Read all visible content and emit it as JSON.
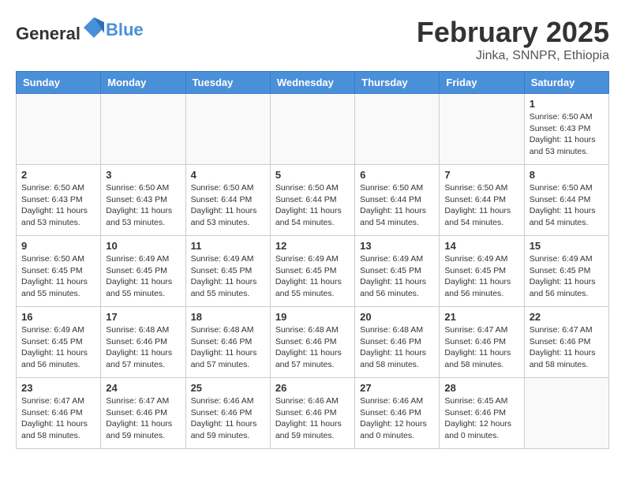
{
  "header": {
    "logo_general": "General",
    "logo_blue": "Blue",
    "month": "February 2025",
    "location": "Jinka, SNNPR, Ethiopia"
  },
  "weekdays": [
    "Sunday",
    "Monday",
    "Tuesday",
    "Wednesday",
    "Thursday",
    "Friday",
    "Saturday"
  ],
  "weeks": [
    [
      {
        "day": "",
        "info": ""
      },
      {
        "day": "",
        "info": ""
      },
      {
        "day": "",
        "info": ""
      },
      {
        "day": "",
        "info": ""
      },
      {
        "day": "",
        "info": ""
      },
      {
        "day": "",
        "info": ""
      },
      {
        "day": "1",
        "info": "Sunrise: 6:50 AM\nSunset: 6:43 PM\nDaylight: 11 hours and 53 minutes."
      }
    ],
    [
      {
        "day": "2",
        "info": "Sunrise: 6:50 AM\nSunset: 6:43 PM\nDaylight: 11 hours and 53 minutes."
      },
      {
        "day": "3",
        "info": "Sunrise: 6:50 AM\nSunset: 6:43 PM\nDaylight: 11 hours and 53 minutes."
      },
      {
        "day": "4",
        "info": "Sunrise: 6:50 AM\nSunset: 6:44 PM\nDaylight: 11 hours and 53 minutes."
      },
      {
        "day": "5",
        "info": "Sunrise: 6:50 AM\nSunset: 6:44 PM\nDaylight: 11 hours and 54 minutes."
      },
      {
        "day": "6",
        "info": "Sunrise: 6:50 AM\nSunset: 6:44 PM\nDaylight: 11 hours and 54 minutes."
      },
      {
        "day": "7",
        "info": "Sunrise: 6:50 AM\nSunset: 6:44 PM\nDaylight: 11 hours and 54 minutes."
      },
      {
        "day": "8",
        "info": "Sunrise: 6:50 AM\nSunset: 6:44 PM\nDaylight: 11 hours and 54 minutes."
      }
    ],
    [
      {
        "day": "9",
        "info": "Sunrise: 6:50 AM\nSunset: 6:45 PM\nDaylight: 11 hours and 55 minutes."
      },
      {
        "day": "10",
        "info": "Sunrise: 6:49 AM\nSunset: 6:45 PM\nDaylight: 11 hours and 55 minutes."
      },
      {
        "day": "11",
        "info": "Sunrise: 6:49 AM\nSunset: 6:45 PM\nDaylight: 11 hours and 55 minutes."
      },
      {
        "day": "12",
        "info": "Sunrise: 6:49 AM\nSunset: 6:45 PM\nDaylight: 11 hours and 55 minutes."
      },
      {
        "day": "13",
        "info": "Sunrise: 6:49 AM\nSunset: 6:45 PM\nDaylight: 11 hours and 56 minutes."
      },
      {
        "day": "14",
        "info": "Sunrise: 6:49 AM\nSunset: 6:45 PM\nDaylight: 11 hours and 56 minutes."
      },
      {
        "day": "15",
        "info": "Sunrise: 6:49 AM\nSunset: 6:45 PM\nDaylight: 11 hours and 56 minutes."
      }
    ],
    [
      {
        "day": "16",
        "info": "Sunrise: 6:49 AM\nSunset: 6:45 PM\nDaylight: 11 hours and 56 minutes."
      },
      {
        "day": "17",
        "info": "Sunrise: 6:48 AM\nSunset: 6:46 PM\nDaylight: 11 hours and 57 minutes."
      },
      {
        "day": "18",
        "info": "Sunrise: 6:48 AM\nSunset: 6:46 PM\nDaylight: 11 hours and 57 minutes."
      },
      {
        "day": "19",
        "info": "Sunrise: 6:48 AM\nSunset: 6:46 PM\nDaylight: 11 hours and 57 minutes."
      },
      {
        "day": "20",
        "info": "Sunrise: 6:48 AM\nSunset: 6:46 PM\nDaylight: 11 hours and 58 minutes."
      },
      {
        "day": "21",
        "info": "Sunrise: 6:47 AM\nSunset: 6:46 PM\nDaylight: 11 hours and 58 minutes."
      },
      {
        "day": "22",
        "info": "Sunrise: 6:47 AM\nSunset: 6:46 PM\nDaylight: 11 hours and 58 minutes."
      }
    ],
    [
      {
        "day": "23",
        "info": "Sunrise: 6:47 AM\nSunset: 6:46 PM\nDaylight: 11 hours and 58 minutes."
      },
      {
        "day": "24",
        "info": "Sunrise: 6:47 AM\nSunset: 6:46 PM\nDaylight: 11 hours and 59 minutes."
      },
      {
        "day": "25",
        "info": "Sunrise: 6:46 AM\nSunset: 6:46 PM\nDaylight: 11 hours and 59 minutes."
      },
      {
        "day": "26",
        "info": "Sunrise: 6:46 AM\nSunset: 6:46 PM\nDaylight: 11 hours and 59 minutes."
      },
      {
        "day": "27",
        "info": "Sunrise: 6:46 AM\nSunset: 6:46 PM\nDaylight: 12 hours and 0 minutes."
      },
      {
        "day": "28",
        "info": "Sunrise: 6:45 AM\nSunset: 6:46 PM\nDaylight: 12 hours and 0 minutes."
      },
      {
        "day": "",
        "info": ""
      }
    ]
  ]
}
